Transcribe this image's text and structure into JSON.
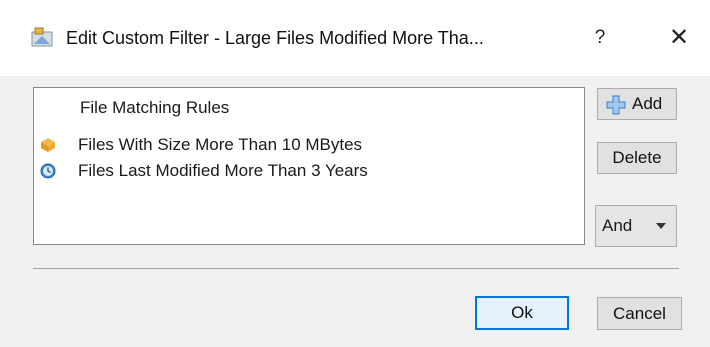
{
  "window": {
    "title": "Edit Custom Filter - Large Files Modified More Tha...",
    "help_label": "?",
    "close_label": "✕"
  },
  "rules_list": {
    "header": "File Matching Rules",
    "items": [
      {
        "label": "Files With Size More Than 10 MBytes",
        "icon": "file-size-icon",
        "icon_color": "#f0a32a"
      },
      {
        "label": "Files Last Modified More Than 3 Years",
        "icon": "clock-icon",
        "icon_color": "#2f7fd1"
      }
    ]
  },
  "buttons": {
    "add_label": "Add",
    "delete_label": "Delete",
    "operator_selected": "And",
    "ok_label": "Ok",
    "cancel_label": "Cancel"
  },
  "colors": {
    "accent": "#0078d7",
    "window_bg": "#f0f0f0",
    "button_bg": "#e1e1e1"
  }
}
